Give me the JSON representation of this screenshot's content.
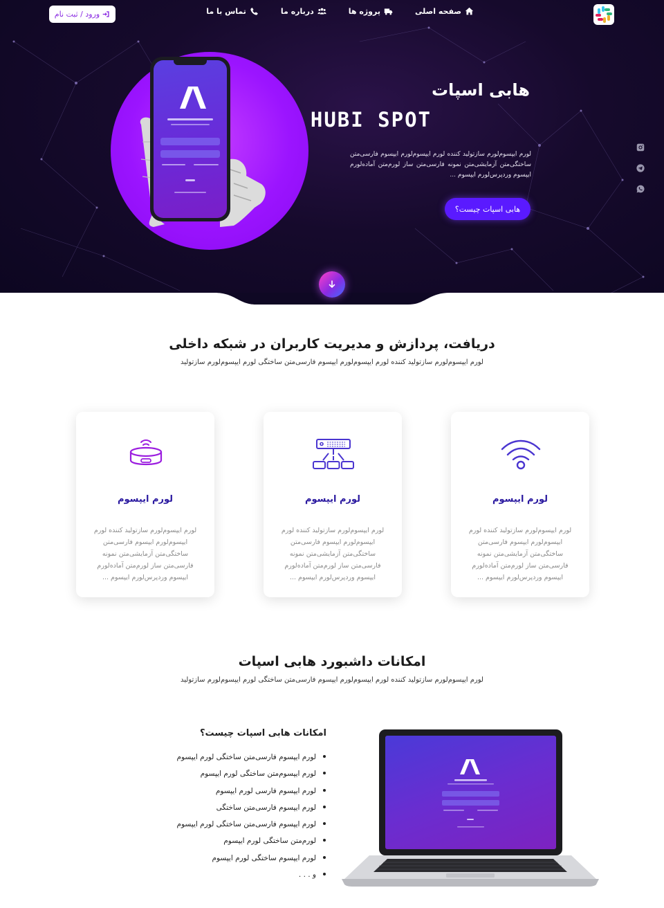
{
  "nav": {
    "items": [
      {
        "label": "صفحه اصلی",
        "icon": "home-icon"
      },
      {
        "label": "پروژه ها",
        "icon": "truck-icon"
      },
      {
        "label": "درباره ما",
        "icon": "users-icon"
      },
      {
        "label": "تماس با ما",
        "icon": "phone-icon"
      }
    ],
    "login_label": "ورود / ثبت نام"
  },
  "hero": {
    "title_fa": "هابی اسپات",
    "title_en": "HUBI SPOT",
    "description": "لورم ایپسوم‌لورم سازتولید کننده لورم ایپسوم‌لورم ایپسوم فارسی‌متن ساختگی‌متن آزمایشی‌متن نمونه فارسی‌متن ساز لورم‌متن آماده‌لورم ایپسوم وردپرس‌لورم ایپسوم ...",
    "cta_label": "هابی اسپات چیست؟",
    "colors": {
      "accent": "#5a1aff",
      "circle": "#9b14ff",
      "background": "#160a2c"
    }
  },
  "section_one": {
    "title": "دریافت، پردازش و مدیریت کاربران در شبکه داخلی",
    "subtitle": "لورم ایپسوم‌لورم سازتولید کننده لورم ایپسوم‌لورم ایپسوم فارسی‌متن ساختگی لورم ایپسوم‌لورم سازتولید",
    "cards": [
      {
        "icon": "wifi-icon",
        "title": "لورم ایپسوم",
        "text": "لورم ایپسوم‌لورم سازتولید کننده لورم ایپسوم‌لورم ایپسوم فارسی‌متن ساختگی‌متن آزمایشی‌متن نمونه فارسی‌متن ساز لورم‌متن آماده‌لورم ایپسوم وردپرس‌لورم ایپسوم ..."
      },
      {
        "icon": "network-switch-icon",
        "title": "لورم ایپسوم",
        "text": "لورم ایپسوم‌لورم سازتولید کننده لورم ایپسوم‌لورم ایپسوم فارسی‌متن ساختگی‌متن آزمایشی‌متن نمونه فارسی‌متن ساز لورم‌متن آماده‌لورم ایپسوم وردپرس‌لورم ایپسوم ..."
      },
      {
        "icon": "router-icon",
        "title": "لورم ایپسوم",
        "text": "لورم ایپسوم‌لورم سازتولید کننده لورم ایپسوم‌لورم ایپسوم فارسی‌متن ساختگی‌متن آزمایشی‌متن نمونه فارسی‌متن ساز لورم‌متن آماده‌لورم ایپسوم وردپرس‌لورم ایپسوم ..."
      }
    ]
  },
  "section_two": {
    "title": "امکانات داشبورد هابی اسپات",
    "subtitle": "لورم ایپسوم‌لورم سازتولید کننده لورم ایپسوم‌لورم ایپسوم فارسی‌متن ساختگی لورم ایپسوم‌لورم سازتولید",
    "features_title": "امکانات هابی اسپات چیست؟",
    "features": [
      "لورم ایپسوم فارسی‌متن ساختگی لورم ایپسوم",
      "لورم ایپسوم‌متن ساختگی لورم ایپسوم",
      "لورم ایپسوم فارسی لورم ایپسوم",
      "لورم ایپسوم فارسی‌متن ساختگی",
      "لورم ایپسوم فارسی‌متن ساختگی لورم ایپسوم",
      "لورم‌متن ساختگی لورم ایپسوم",
      "لورم ایپسوم ساختگی لورم ایپسوم",
      "و . . ."
    ]
  }
}
